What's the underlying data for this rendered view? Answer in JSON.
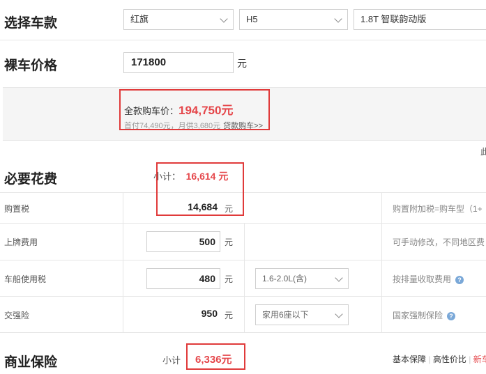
{
  "select_car": {
    "title": "选择车款",
    "brand": "红旗",
    "model": "H5",
    "trim": "1.8T 智联韵动版"
  },
  "bare_price": {
    "title": "裸车价格",
    "value": "171800",
    "unit": "元"
  },
  "full_price": {
    "label": "全款购车价：",
    "value": "194,750元",
    "detail": "首付74,490元，月供3,680元",
    "loan_link": "贷款购车",
    "loan_arrow": ">>",
    "edge_text": "此"
  },
  "required": {
    "title": "必要花费",
    "subtotal_label": "小计：",
    "subtotal_value": "16,614 元",
    "rows": [
      {
        "name": "购置税",
        "value": "14,684",
        "unit": "元",
        "note": "购置附加税=购车型（1+"
      },
      {
        "name": "上牌费用",
        "value": "500",
        "unit": "元",
        "note": "可手动修改，不同地区费"
      },
      {
        "name": "车船使用税",
        "value": "480",
        "unit": "元",
        "option": "1.6-2.0L(含)",
        "note": "按排量收取费用"
      },
      {
        "name": "交强险",
        "value": "950",
        "unit": "元",
        "option": "家用6座以下",
        "note": "国家强制保险"
      }
    ]
  },
  "commercial": {
    "title": "商业保险",
    "subtotal_label": "小计",
    "subtotal_value": "6,336元",
    "tabs": [
      "基本保障",
      "高性价比",
      "新车"
    ],
    "separator": "|"
  },
  "colors": {
    "accent_red": "#e5474b",
    "box_red": "#e03a3a",
    "info_blue": "#7aa8d8"
  }
}
